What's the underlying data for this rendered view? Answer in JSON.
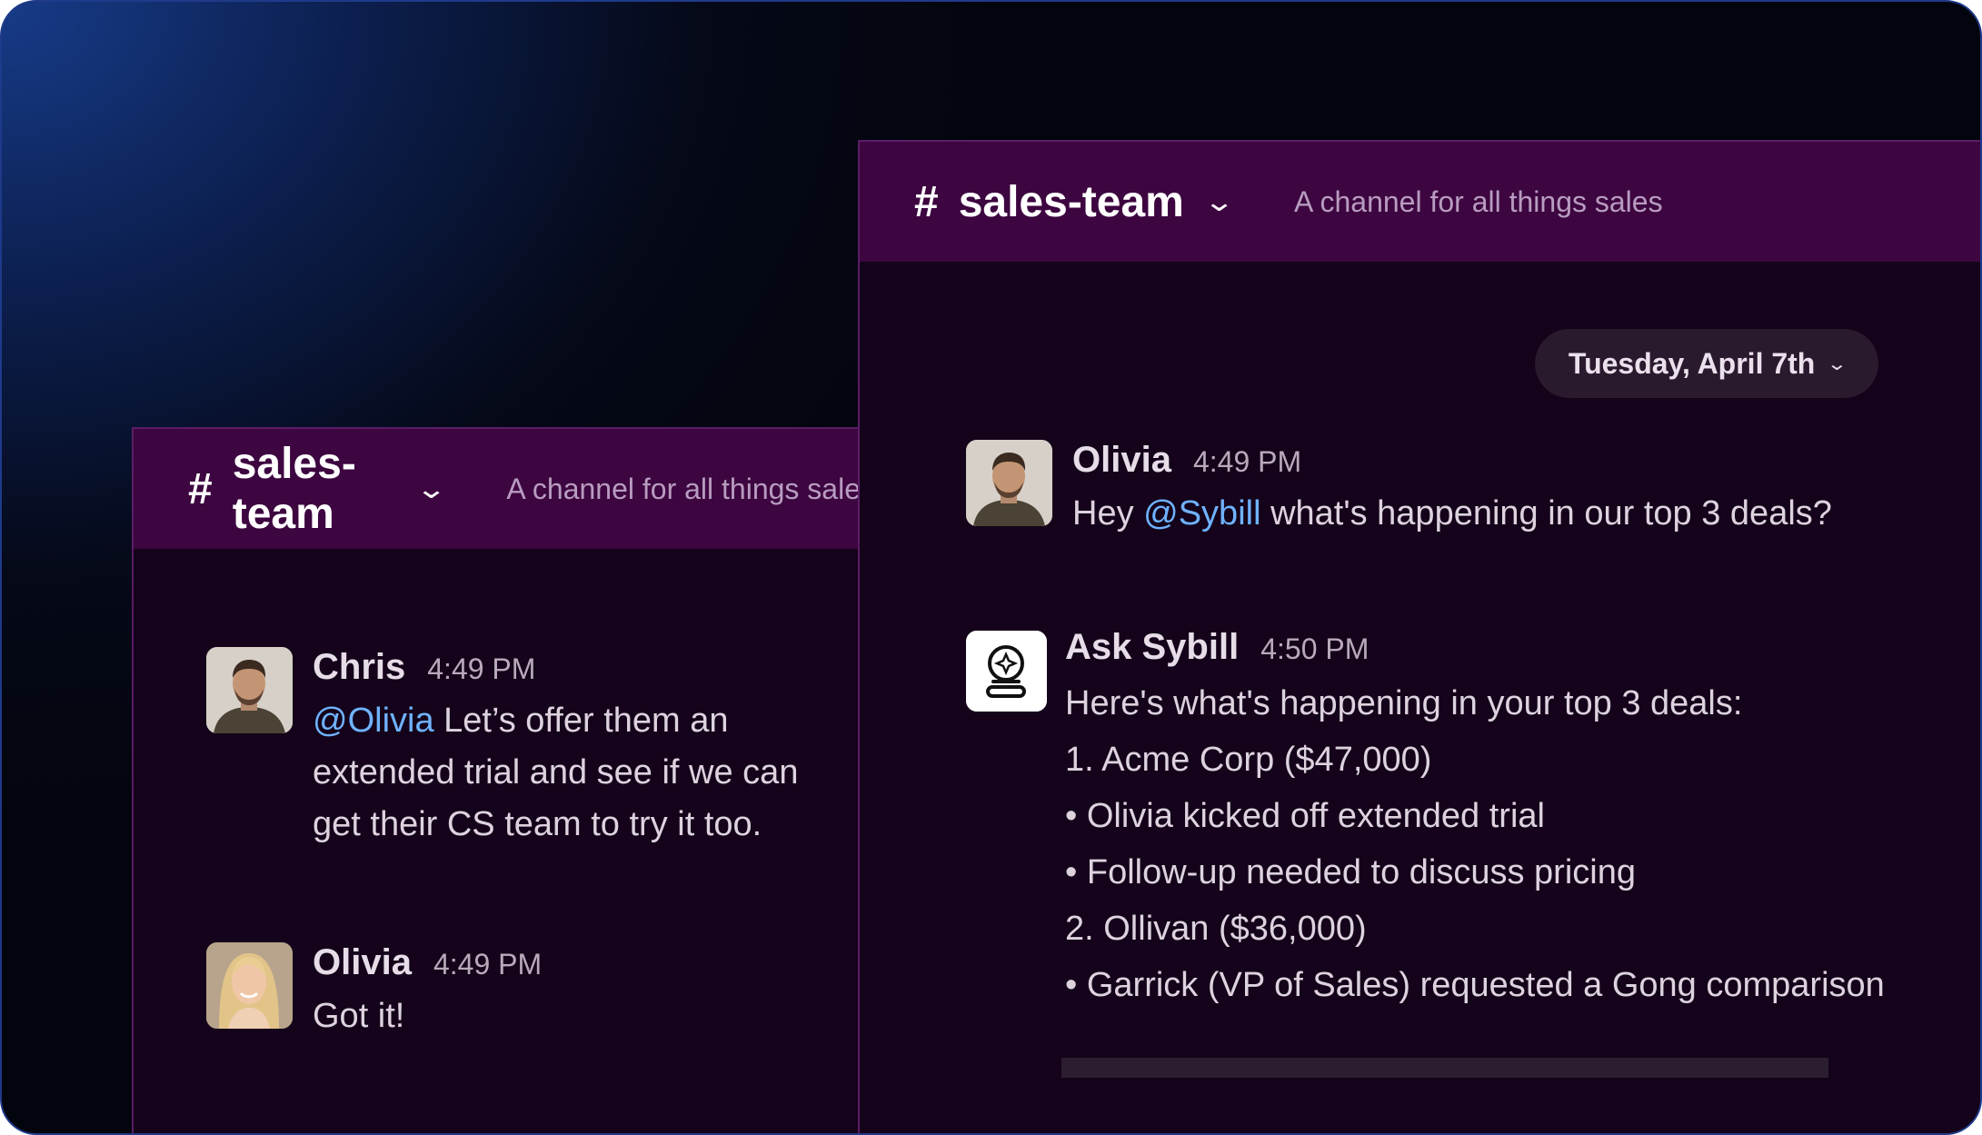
{
  "left_panel": {
    "header": {
      "hash": "#",
      "channel": "sales-team",
      "chevron": "chevron-down-icon",
      "description": "A channel for all things sales"
    },
    "messages": [
      {
        "name": "Chris",
        "time": "4:49 PM",
        "mention": "@Olivia",
        "line1": " Let’s offer them an",
        "line2": "extended trial and see if we can",
        "line3": "get their CS team to try it too."
      },
      {
        "name": "Olivia",
        "time": "4:49 PM",
        "text": "Got it!"
      }
    ]
  },
  "right_panel": {
    "header": {
      "hash": "#",
      "channel": "sales-team",
      "chevron": "chevron-down-icon",
      "description": "A channel for all things sales"
    },
    "date_pill": {
      "label": "Tuesday, April 7th",
      "chevron": "chevron-down-icon"
    },
    "messages": [
      {
        "name": "Olivia",
        "time": "4:49 PM",
        "prefix": "Hey ",
        "mention": "@Sybill",
        "suffix": " what's happening in our top 3 deals?"
      },
      {
        "name": "Ask Sybill",
        "time": "4:50 PM",
        "lines": [
          "Here's what's happening in your top 3 deals:",
          "1. Acme Corp ($47,000)",
          "• Olivia kicked off extended trial",
          "• Follow-up needed to discuss pricing",
          "2. Ollivan ($36,000)",
          "• Garrick (VP of Sales) requested a Gong comparison"
        ]
      }
    ]
  },
  "colors": {
    "header_bg": "#3d0640",
    "panel_bg": "#14031a",
    "mention": "#6fb2ff"
  }
}
